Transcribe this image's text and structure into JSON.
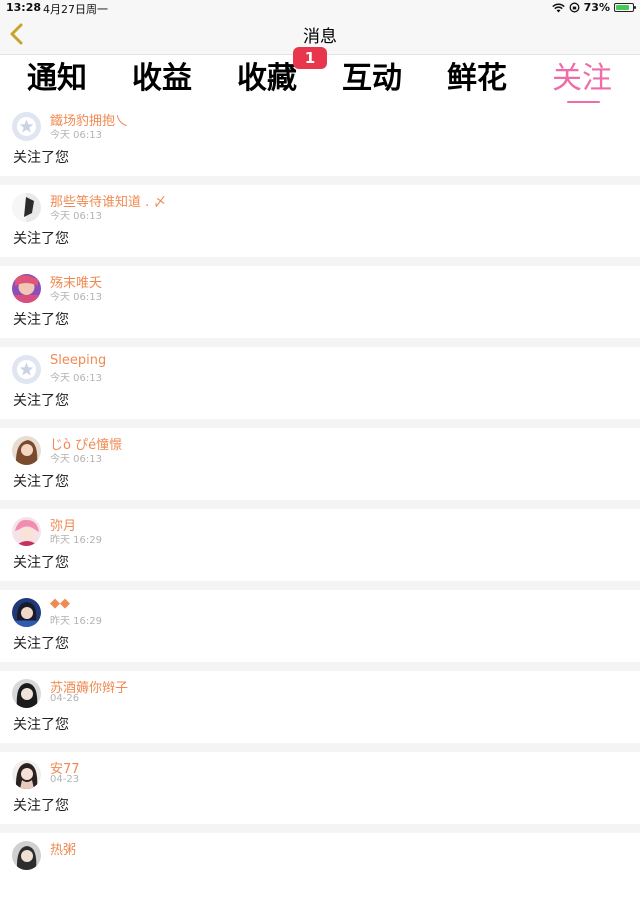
{
  "status_bar": {
    "time": "13:28",
    "date": "4月27日周一",
    "battery_percent": "73%"
  },
  "nav": {
    "title": "消息"
  },
  "tabs": [
    {
      "label": "通知"
    },
    {
      "label": "收益"
    },
    {
      "label": "收藏"
    },
    {
      "label": "互动"
    },
    {
      "label": "鲜花"
    },
    {
      "label": "关注"
    }
  ],
  "active_tab": "关注",
  "badge": {
    "tab": "收藏",
    "count": "1",
    "color": "#e8364d"
  },
  "colors": {
    "accent": "#f06ca8",
    "username": "#f08a52",
    "secondary_text": "#b3b3b3"
  },
  "items": [
    {
      "username": "鐵场豹拥抱乀",
      "time": "今天 06:13",
      "action": "关注了您",
      "avatar": "default-star-icon"
    },
    {
      "username": "那些等待谁知道 . 〆",
      "time": "今天 06:13",
      "action": "关注了您",
      "avatar": "photo"
    },
    {
      "username": "殇末唯夭",
      "time": "今天 06:13",
      "action": "关注了您",
      "avatar": "photo"
    },
    {
      "username": "Sleeping",
      "time": "今天 06:13",
      "action": "关注了您",
      "avatar": "default-star-icon"
    },
    {
      "username": "じò ぴé憧憬",
      "time": "今天 06:13",
      "action": "关注了您",
      "avatar": "photo"
    },
    {
      "username": "弥月",
      "time": "昨天 16:29",
      "action": "关注了您",
      "avatar": "photo"
    },
    {
      "username": "◆◆",
      "time": "昨天 16:29",
      "action": "关注了您",
      "avatar": "photo"
    },
    {
      "username": "苏酒薅你辫子",
      "time": "04-26",
      "action": "关注了您",
      "avatar": "photo"
    },
    {
      "username": "安77",
      "time": "04-23",
      "action": "关注了您",
      "avatar": "photo"
    },
    {
      "username": "热粥",
      "time": "",
      "action": "",
      "avatar": "photo"
    }
  ]
}
